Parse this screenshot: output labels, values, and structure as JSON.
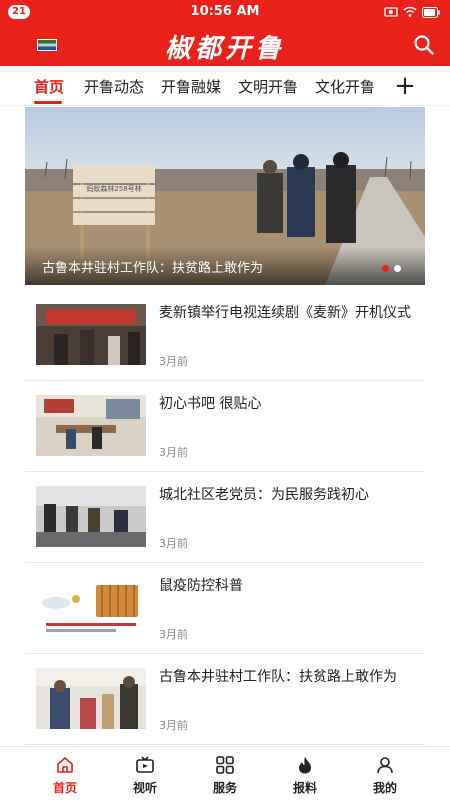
{
  "status_bar": {
    "badge": "21",
    "time": "10:56 AM"
  },
  "header": {
    "logo": "椒都开鲁",
    "search_icon": "search-icon",
    "flag_icon": "flag-icon"
  },
  "tabs": [
    {
      "label": "首页",
      "active": true
    },
    {
      "label": "开鲁动态",
      "active": false
    },
    {
      "label": "开鲁融媒",
      "active": false
    },
    {
      "label": "文明开鲁",
      "active": false
    },
    {
      "label": "文化开鲁",
      "active": false
    }
  ],
  "tab_add": "+",
  "banner": {
    "title": "古鲁本井驻村工作队：扶贫路上敢作为",
    "sign_text": "蚂蚁森林258号林",
    "slide_index": 1,
    "slide_count": 2
  },
  "news": [
    {
      "title": "麦新镇举行电视连续剧《麦新》开机仪式",
      "time": "3月前"
    },
    {
      "title": "初心书吧 很贴心",
      "time": "3月前"
    },
    {
      "title": "城北社区老党员：为民服务践初心",
      "time": "3月前"
    },
    {
      "title": "鼠疫防控科普",
      "time": "3月前"
    },
    {
      "title": "古鲁本井驻村工作队：扶贫路上敢作为",
      "time": "3月前"
    }
  ],
  "bottom_nav": [
    {
      "label": "首页",
      "icon": "home-icon",
      "active": true
    },
    {
      "label": "视听",
      "icon": "tv-icon",
      "active": false
    },
    {
      "label": "服务",
      "icon": "grid-icon",
      "active": false
    },
    {
      "label": "报料",
      "icon": "fire-icon",
      "active": false
    },
    {
      "label": "我的",
      "icon": "user-icon",
      "active": false
    }
  ],
  "colors": {
    "accent": "#e8211a",
    "text": "#222222",
    "muted": "#888888"
  }
}
